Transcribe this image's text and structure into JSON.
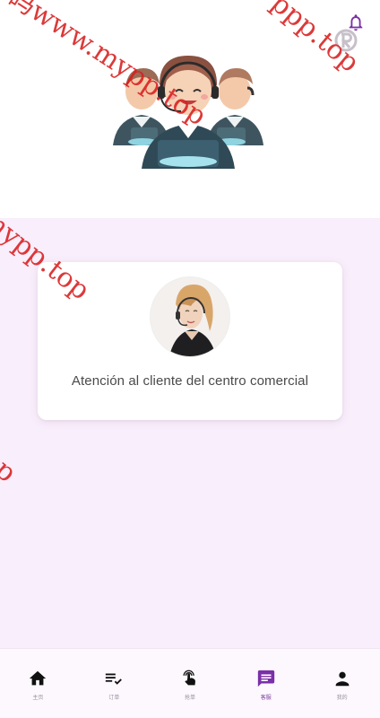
{
  "header": {
    "bell_icon": "bell-icon",
    "badge_icon": "r-badge-icon",
    "illustration": "customer-service-team-illustration"
  },
  "card": {
    "title": "Atención al cliente del centro comercial",
    "avatar": "headset-agent-photo"
  },
  "bottom_nav": {
    "items": [
      {
        "label": "主页",
        "icon": "home-icon"
      },
      {
        "label": "订单",
        "icon": "list-check-icon"
      },
      {
        "label": "抢单",
        "icon": "tap-hand-icon"
      },
      {
        "label": "客服",
        "icon": "chat-icon"
      },
      {
        "label": "我的",
        "icon": "person-icon"
      }
    ],
    "active_index": 3
  },
  "watermark": {
    "lines": [
      "码www.mypp.top",
      "ppp.top",
      "mypp.top",
      "op"
    ]
  },
  "colors": {
    "accent": "#7b2fa8",
    "background": "#f9eefb",
    "card": "#ffffff",
    "watermark": "#d71e1e"
  }
}
